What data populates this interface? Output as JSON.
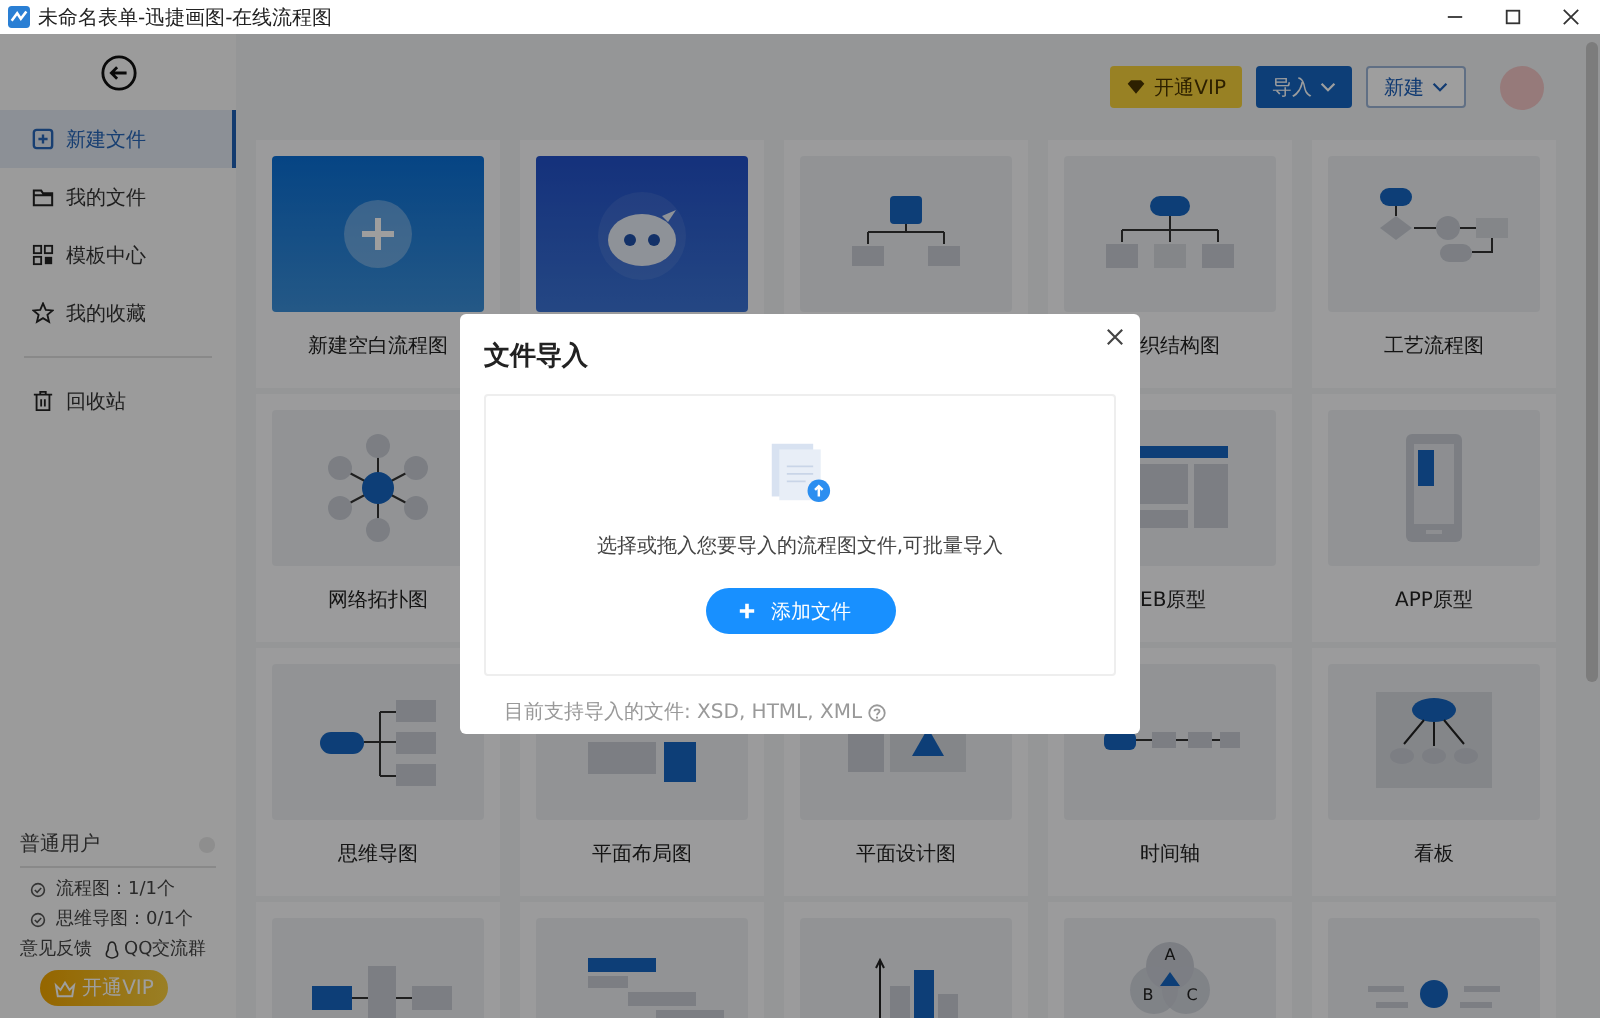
{
  "window": {
    "title": "未命名表单-迅捷画图-在线流程图"
  },
  "sidebar": {
    "items": [
      {
        "label": "新建文件",
        "selected": true
      },
      {
        "label": "我的文件",
        "selected": false
      },
      {
        "label": "模板中心",
        "selected": false
      },
      {
        "label": "我的收藏",
        "selected": false
      }
    ],
    "trash": {
      "label": "回收站"
    },
    "account": {
      "plan": "普通用户",
      "quotas": [
        "流程图：1/1个",
        "思维导图：0/1个"
      ],
      "links": [
        "意见反馈",
        "QQ交流群"
      ],
      "vip_button": "开通VIP"
    }
  },
  "toolbar": {
    "vip": "开通VIP",
    "import": "导入",
    "new": "新建"
  },
  "templates": [
    {
      "kind": "blank",
      "label": "新建空白流程图"
    },
    {
      "kind": "robot"
    },
    {
      "kind": "tree"
    },
    {
      "kind": "org",
      "label": "织结构图"
    },
    {
      "kind": "process",
      "label": "工艺流程图"
    },
    {
      "kind": "network",
      "label": "网络拓扑图"
    },
    {
      "kind": "web",
      "label": "EB原型"
    },
    {
      "kind": "app",
      "label": "APP原型"
    },
    {
      "kind": "mindmap",
      "label": "思维导图"
    },
    {
      "kind": "layout",
      "label": "平面布局图"
    },
    {
      "kind": "design",
      "label": "平面设计图"
    },
    {
      "kind": "timeline",
      "label": "时间轴"
    },
    {
      "kind": "board",
      "label": "看板"
    },
    {
      "kind": "relation"
    },
    {
      "kind": "gantt"
    },
    {
      "kind": "bars"
    },
    {
      "kind": "venn",
      "letters": [
        "A",
        "B",
        "C"
      ]
    },
    {
      "kind": "person"
    }
  ],
  "dialog": {
    "title": "文件导入",
    "hint": "选择或拖入您要导入的流程图文件,可批量导入",
    "button": "添加文件",
    "note": "目前支持导入的文件: XSD, HTML, XML"
  }
}
